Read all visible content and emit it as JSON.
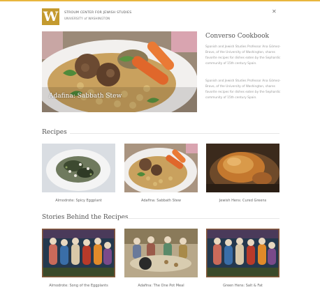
{
  "header": {
    "logo_letter": "W",
    "org_name": "STROUM CENTER FOR JEWISH STUDIES",
    "org_sub": "UNIVERSITY of WASHINGTON",
    "menu_icon": "close-icon"
  },
  "hero": {
    "caption": "Adafina: Sabbath Stew"
  },
  "sidebar": {
    "title": "Converso Cookbook",
    "paragraph1": "Spanish and Jewish Studies Professor Ana Gómez-Bravo, of the University of Washington, shares favorite recipes for dishes eaten by the Sephardic community of 15th century Spain.",
    "paragraph2": "Spanish and Jewish Studies Professor Ana Gómez-Bravo, of the University of Washington, shares favorite recipes for dishes eaten by the Sephardic community of 15th century Spain."
  },
  "recipes": {
    "title": "Recipes",
    "items": [
      {
        "caption": "Almodrote: Spicy Eggplant"
      },
      {
        "caption": "Adafina: Sabbath Stew"
      },
      {
        "caption": "Jewish Hens: Cured Greens"
      }
    ]
  },
  "stories": {
    "title": "Stories Behind the Recipes",
    "items": [
      {
        "caption": "Almodrote: Song of the Eggplants"
      },
      {
        "caption": "Adafina: The One Pot Meal"
      },
      {
        "caption": "Green Hens: Salt & Fat"
      }
    ]
  },
  "colors": {
    "accent": "#e8b63e",
    "logo_bg": "#c49a2e"
  }
}
